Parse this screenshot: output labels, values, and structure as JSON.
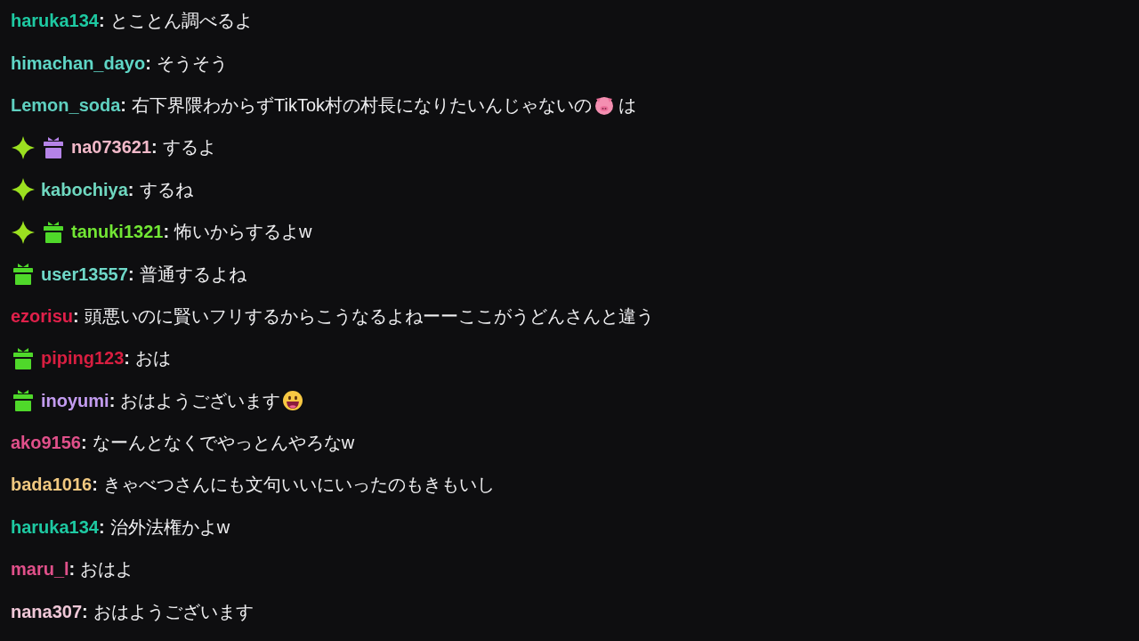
{
  "messages": [
    {
      "user": "haruka134",
      "color": "#1ec9a2",
      "colon": ":",
      "message": [
        {
          "kind": "text",
          "text": "とことん調べるよ"
        }
      ]
    },
    {
      "user": "himachan_dayo",
      "color": "#5fd6c6",
      "colon": ":",
      "message": [
        {
          "kind": "text",
          "text": "そうそう"
        }
      ]
    },
    {
      "user": "Lemon_soda",
      "color": "#5fd0c0",
      "colon": ":",
      "message": [
        {
          "kind": "text",
          "text": "右下界隈わからずTikTok村の村長になりたいんじゃないの"
        },
        {
          "kind": "pig"
        },
        {
          "kind": "text",
          "text": "は"
        }
      ]
    },
    {
      "badges": [
        {
          "kind": "sparkle",
          "color": "#9be020"
        },
        {
          "kind": "gift",
          "color": "#b583e8"
        }
      ],
      "user": "na073621",
      "color": "#f2b9c9",
      "colon": ":",
      "message": [
        {
          "kind": "text",
          "text": "するよ"
        }
      ]
    },
    {
      "badges": [
        {
          "kind": "sparkle",
          "color": "#9be020"
        }
      ],
      "user": "kabochiya",
      "color": "#6fd8c0",
      "colon": ":",
      "message": [
        {
          "kind": "text",
          "text": "するね"
        }
      ]
    },
    {
      "badges": [
        {
          "kind": "sparkle",
          "color": "#9be020"
        },
        {
          "kind": "gift",
          "color": "#4fd82a"
        }
      ],
      "user": "tanuki1321",
      "color": "#72e634",
      "colon": ":",
      "message": [
        {
          "kind": "text",
          "text": "怖いからするよw"
        }
      ]
    },
    {
      "badges": [
        {
          "kind": "gift",
          "color": "#4fd82a"
        }
      ],
      "user": "user13557",
      "color": "#6fd8c8",
      "colon": ":",
      "message": [
        {
          "kind": "text",
          "text": "普通するよね"
        }
      ]
    },
    {
      "user": "ezorisu",
      "color": "#e0204a",
      "colon": ":",
      "message": [
        {
          "kind": "text",
          "text": "頭悪いのに賢いフリするからこうなるよねーーここがうどんさんと違う"
        }
      ]
    },
    {
      "badges": [
        {
          "kind": "gift",
          "color": "#4fd82a"
        }
      ],
      "user": "piping123",
      "color": "#d81e40",
      "colon": ":",
      "message": [
        {
          "kind": "text",
          "text": "おは"
        }
      ]
    },
    {
      "badges": [
        {
          "kind": "gift",
          "color": "#4fd82a"
        }
      ],
      "user": "inoyumi",
      "color": "#c39cf0",
      "colon": ":",
      "message": [
        {
          "kind": "text",
          "text": "おはようございます"
        },
        {
          "kind": "grin"
        }
      ]
    },
    {
      "user": "ako9156",
      "color": "#e0508a",
      "colon": ":",
      "message": [
        {
          "kind": "text",
          "text": "なーんとなくでやっとんやろなw"
        }
      ]
    },
    {
      "user": "bada1016",
      "color": "#f0c880",
      "colon": ":",
      "message": [
        {
          "kind": "text",
          "text": "きゃべつさんにも文句いいにいったのもきもいし"
        }
      ]
    },
    {
      "user": "haruka134",
      "color": "#1ec9a2",
      "colon": ":",
      "message": [
        {
          "kind": "text",
          "text": "治外法権かよw"
        }
      ]
    },
    {
      "user": "maru_l",
      "color": "#e0508a",
      "colon": ":",
      "message": [
        {
          "kind": "text",
          "text": "おはよ"
        }
      ]
    },
    {
      "user": "nana307",
      "color": "#f0c8d8",
      "colon": ":",
      "message": [
        {
          "kind": "text",
          "text": "おはようございます"
        }
      ]
    }
  ]
}
